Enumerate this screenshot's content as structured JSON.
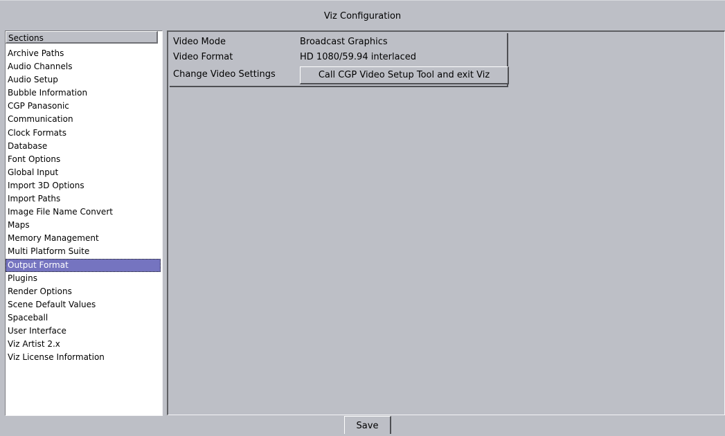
{
  "window": {
    "title": "Viz Configuration"
  },
  "sections": {
    "header": "Sections",
    "items": [
      {
        "label": "Archive Paths"
      },
      {
        "label": "Audio Channels"
      },
      {
        "label": "Audio Setup"
      },
      {
        "label": "Bubble Information"
      },
      {
        "label": "CGP Panasonic"
      },
      {
        "label": "Communication"
      },
      {
        "label": "Clock Formats"
      },
      {
        "label": "Database"
      },
      {
        "label": "Font Options"
      },
      {
        "label": "Global Input"
      },
      {
        "label": "Import 3D Options"
      },
      {
        "label": "Import Paths"
      },
      {
        "label": "Image File Name Convert"
      },
      {
        "label": "Maps"
      },
      {
        "label": "Memory Management"
      },
      {
        "label": "Multi Platform Suite"
      },
      {
        "label": "Output Format",
        "selected": true
      },
      {
        "label": "Plugins"
      },
      {
        "label": "Render Options"
      },
      {
        "label": "Scene Default Values"
      },
      {
        "label": "Spaceball"
      },
      {
        "label": "User Interface"
      },
      {
        "label": "Viz Artist 2.x"
      },
      {
        "label": "Viz License Information"
      }
    ]
  },
  "output_format": {
    "video_mode_label": "Video Mode",
    "video_mode_value": "Broadcast Graphics",
    "video_format_label": "Video Format",
    "video_format_value": "HD 1080/59.94 interlaced",
    "change_settings_label": "Change Video Settings",
    "call_tool_button": "Call CGP Video Setup Tool and exit Viz"
  },
  "footer": {
    "save_label": "Save"
  },
  "colors": {
    "background": "#bdbfc6",
    "list_background": "#ffffff",
    "selection": "#7574c0"
  }
}
